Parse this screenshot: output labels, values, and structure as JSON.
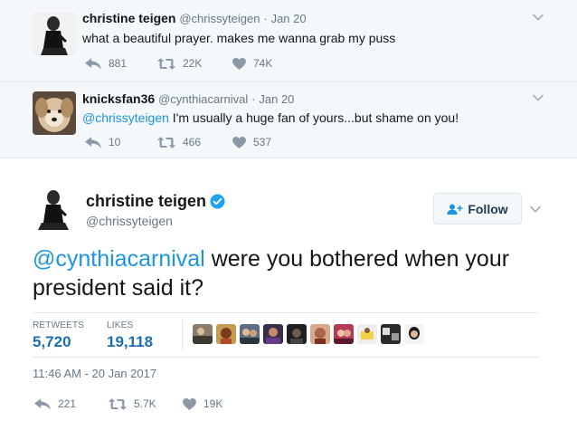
{
  "thread": [
    {
      "fullname": "christine teigen",
      "handle": "@chrissyteigen",
      "time": "Jan 20",
      "text": "what a beautiful prayer. makes me wanna grab my puss",
      "replies": "881",
      "retweets": "22K",
      "likes": "74K"
    },
    {
      "fullname": "knicksfan36",
      "handle": "@cynthiacarnival",
      "time": "Jan 20",
      "mention": "@chrissyteigen",
      "text": " I'm usually a huge fan of yours...but shame on you!",
      "replies": "10",
      "retweets": "466",
      "likes": "537"
    }
  ],
  "main_tweet": {
    "fullname": "christine teigen",
    "handle": "@chrissyteigen",
    "follow_label": "Follow",
    "mention": "@cynthiacarnival",
    "text": " were you bothered when your president said it?",
    "retweets_label": "RETWEETS",
    "retweets_count": "5,720",
    "likes_label": "LIKES",
    "likes_count": "19,118",
    "timestamp": "11:46 AM - 20 Jan 2017",
    "replies": "221",
    "retweets_short": "5.7K",
    "likes_short": "19K"
  },
  "colors": {
    "link": "#1b95e0",
    "muted": "#657786",
    "verified": "#1da1f2",
    "thread_bg": "#f5f8fa"
  },
  "icons": [
    "reply-icon",
    "retweet-icon",
    "heart-icon",
    "chevron-down-icon",
    "verified-badge-icon",
    "follow-person-plus-icon"
  ]
}
